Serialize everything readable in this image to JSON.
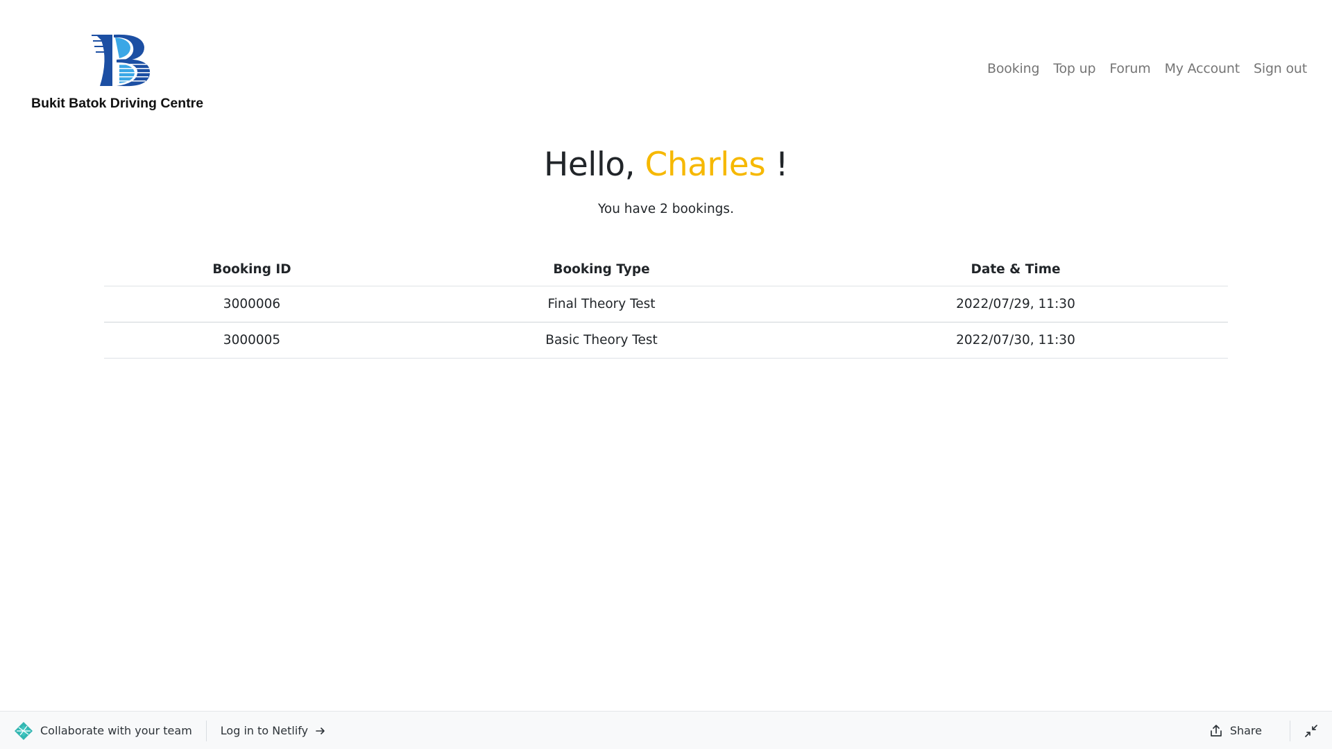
{
  "brand": {
    "name": "Bukit Batok Driving Centre",
    "logo_icon": "bbdc-logo-icon",
    "colors": {
      "dark_blue": "#1c4fa3",
      "light_blue": "#3ba7e6"
    }
  },
  "nav": {
    "items": [
      "Booking",
      "Top up",
      "Forum",
      "My Account",
      "Sign out"
    ]
  },
  "greeting": {
    "prefix": "Hello, ",
    "username": "Charles",
    "suffix": " !",
    "accent_color": "#f6b800"
  },
  "summary": "You have 2 bookings.",
  "bookings": {
    "headers": [
      "Booking ID",
      "Booking Type",
      "Date & Time"
    ],
    "rows": [
      [
        "3000006",
        "Final Theory Test",
        "2022/07/29, 11:30"
      ],
      [
        "3000005",
        "Basic Theory Test",
        "2022/07/30, 11:30"
      ]
    ]
  },
  "netlify_bar": {
    "collaborate_label": "Collaborate with your team",
    "login_label": "Log in to Netlify",
    "share_label": "Share",
    "icons": [
      "netlify-logo-icon",
      "arrow-right-icon",
      "share-icon",
      "collapse-icon"
    ]
  }
}
